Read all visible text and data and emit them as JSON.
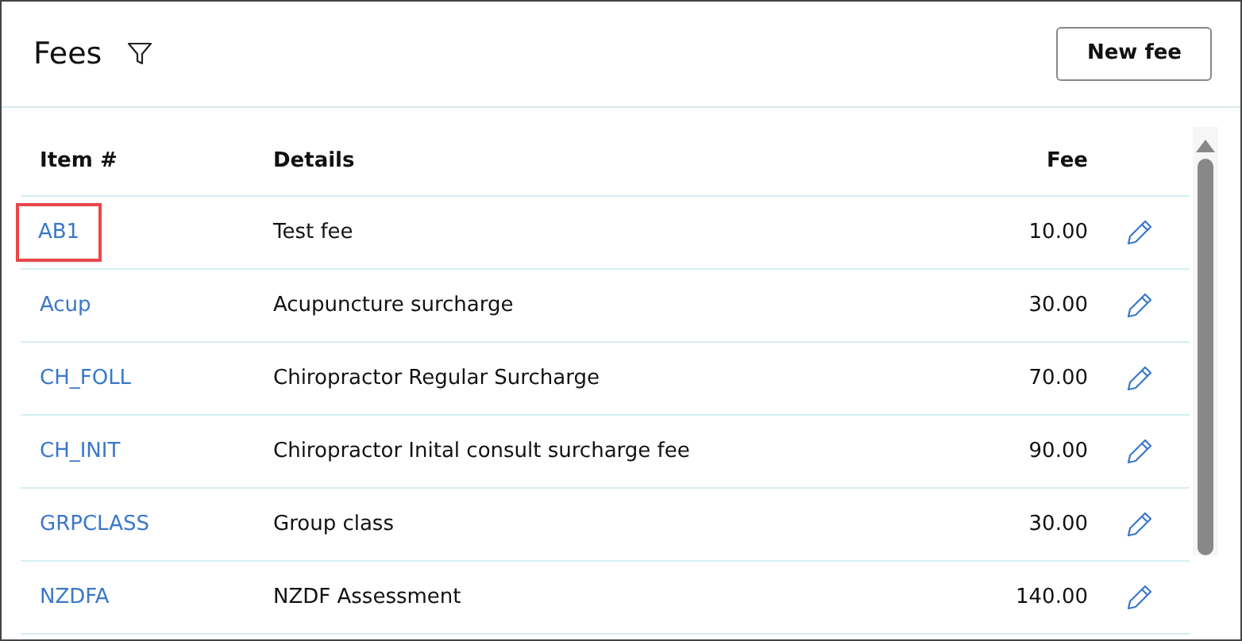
{
  "header": {
    "title": "Fees",
    "button": "New fee"
  },
  "table": {
    "columns": [
      "Item #",
      "Details",
      "Fee"
    ],
    "rows": [
      {
        "item": "AB1",
        "details": "Test fee",
        "fee": "10.00",
        "highlighted": true
      },
      {
        "item": "Acup",
        "details": "Acupuncture surcharge",
        "fee": "30.00",
        "highlighted": false
      },
      {
        "item": "CH_FOLL",
        "details": "Chiropractor Regular Surcharge",
        "fee": "70.00",
        "highlighted": false
      },
      {
        "item": "CH_INIT",
        "details": "Chiropractor Inital consult surcharge fee",
        "fee": "90.00",
        "highlighted": false
      },
      {
        "item": "GRPCLASS",
        "details": "Group class",
        "fee": "30.00",
        "highlighted": false
      },
      {
        "item": "NZDFA",
        "details": "NZDF Assessment",
        "fee": "140.00",
        "highlighted": false
      }
    ]
  }
}
